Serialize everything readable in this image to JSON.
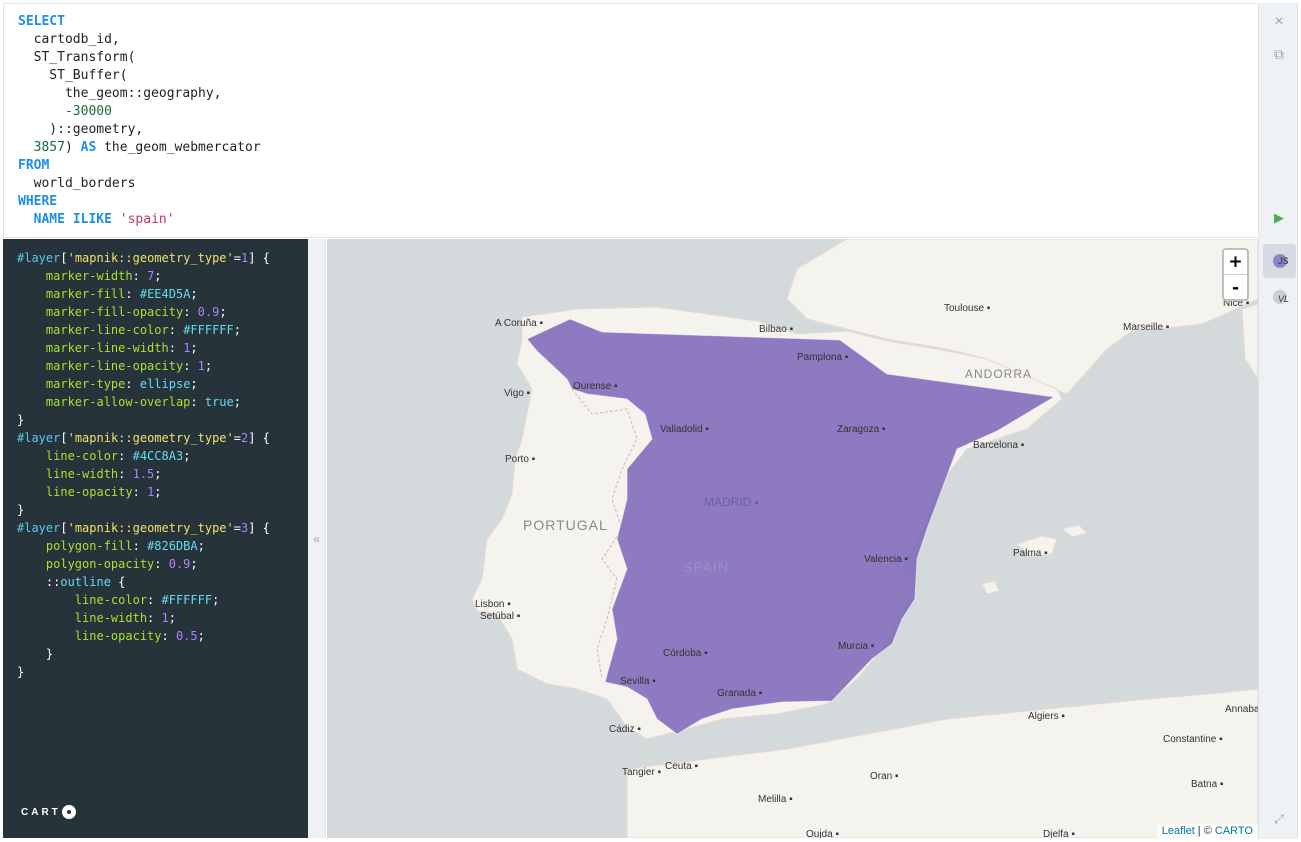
{
  "sql": {
    "lines": [
      "SELECT",
      "  cartodb_id,",
      "  ST_Transform(",
      "    ST_Buffer(",
      "      the_geom::geography,",
      "      -30000",
      "    )::geometry,",
      "  3857) AS the_geom_webmercator",
      "FROM",
      "  world_borders",
      "WHERE",
      "  NAME ILIKE 'spain'"
    ]
  },
  "rail": {
    "close_icon": "×",
    "copy_icon": "⧉",
    "run_icon": "▶",
    "js_label": "JS",
    "vl_label": "VL",
    "expand_icon": "⤢"
  },
  "divider_icon": "«",
  "cartocss": {
    "lines": [
      "#layer['mapnik::geometry_type'=1] {",
      "    marker-width: 7;",
      "    marker-fill: #EE4D5A;",
      "    marker-fill-opacity: 0.9;",
      "    marker-line-color: #FFFFFF;",
      "    marker-line-width: 1;",
      "    marker-line-opacity: 1;",
      "    marker-type: ellipse;",
      "    marker-allow-overlap: true;",
      "}",
      "#layer['mapnik::geometry_type'=2] {",
      "    line-color: #4CC8A3;",
      "    line-width: 1.5;",
      "    line-opacity: 1;",
      "}",
      "#layer['mapnik::geometry_type'=3] {",
      "    polygon-fill: #826DBA;",
      "    polygon-opacity: 0.9;",
      "    ::outline {",
      "        line-color: #FFFFFF;",
      "        line-width: 1;",
      "        line-opacity: 0.5;",
      "    }",
      "}"
    ]
  },
  "logo": "CARTO",
  "map": {
    "zoom_in": "+",
    "zoom_out": "-",
    "attribution_leaflet": "Leaflet",
    "attribution_sep": " | © ",
    "attribution_carto": "CARTO",
    "polygon_color": "#826DBA",
    "country_labels": [
      "PORTUGAL",
      "SPAIN",
      "ANDORRA"
    ],
    "cities": [
      "Toulouse",
      "A Coruña",
      "Bilbao",
      "Marseille",
      "Nice",
      "Pamplona",
      "Vigo",
      "Ourense",
      "Valladolid",
      "Zaragoza",
      "Barcelona",
      "Porto",
      "MADRID",
      "Palma",
      "Valencia",
      "Lisbon",
      "Setúbal",
      "Córdoba",
      "Murcia",
      "Sevilla",
      "Granada",
      "Algiers",
      "Annaba",
      "Cádiz",
      "Constantine",
      "Tangier",
      "Ceuta",
      "Oran",
      "Melilla",
      "Batna",
      "Oujda",
      "Djelfa"
    ]
  }
}
